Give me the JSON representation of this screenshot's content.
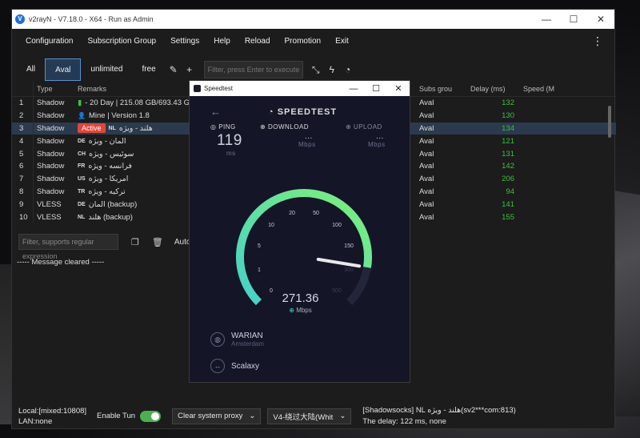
{
  "window": {
    "title": "v2rayN - V7.18.0 - X64 - Run as Admin"
  },
  "menu": [
    "Configuration",
    "Subscription Group",
    "Settings",
    "Help",
    "Reload",
    "Promotion",
    "Exit"
  ],
  "tabs": [
    "All",
    "Aval",
    "unlimited",
    "free"
  ],
  "active_tab": "Aval",
  "search_placeholder": "Filter, press Enter to execute",
  "columns": {
    "num": "",
    "type": "Type",
    "remarks": "Remarks",
    "subs": "Subs grou",
    "delay": "Delay (ms)",
    "speed": "Speed (M"
  },
  "rows": [
    {
      "num": "1",
      "type": "Shadow",
      "remarks": "- 20 Day | 215.08 GB/693.43 GB",
      "subs": "Aval",
      "delay": "132"
    },
    {
      "num": "2",
      "type": "Shadow",
      "remarks": "Mine | Version 1.8",
      "subs": "Aval",
      "delay": "130"
    },
    {
      "num": "3",
      "type": "Shadow",
      "badge": "Active",
      "flag": "NL",
      "remarks": "هلند - ویژه",
      "subs": "Aval",
      "delay": "134"
    },
    {
      "num": "4",
      "type": "Shadow",
      "flag": "DE",
      "remarks": "آلمان - ویژه",
      "subs": "Aval",
      "delay": "121"
    },
    {
      "num": "5",
      "type": "Shadow",
      "flag": "CH",
      "remarks": "سوئیس - ویژه",
      "subs": "Aval",
      "delay": "131"
    },
    {
      "num": "6",
      "type": "Shadow",
      "flag": "FR",
      "remarks": "فرانسه - ویژه",
      "subs": "Aval",
      "delay": "142"
    },
    {
      "num": "7",
      "type": "Shadow",
      "flag": "US",
      "remarks": "آمریکا - ویژه",
      "subs": "Aval",
      "delay": "206"
    },
    {
      "num": "8",
      "type": "Shadow",
      "flag": "TR",
      "remarks": "ترکیه - ویژه",
      "subs": "Aval",
      "delay": "94"
    },
    {
      "num": "9",
      "type": "VLESS",
      "flag": "DE",
      "remarks": "آلمان (backup)",
      "subs": "Aval",
      "delay": "141"
    },
    {
      "num": "10",
      "type": "VLESS",
      "flag": "NL",
      "remarks": "هلند (backup)",
      "subs": "Aval",
      "delay": "155"
    }
  ],
  "msg_filter_placeholder": "Filter, supports regular expression",
  "auto_label": "Auto",
  "message": "----- Message cleared -----",
  "status": {
    "local": "Local:[mixed:10808]",
    "lan": "LAN:none",
    "tun_label": "Enable Tun",
    "proxy_select": "Clear system proxy",
    "routing_select": "V4-绕过大陆(Whit",
    "server_line": "[Shadowsocks] NL هلند - ویژه(sv2***com:813)",
    "delay_line": "The delay: 122 ms, none"
  },
  "speedtest": {
    "title": "Speedtest",
    "logo": "SPEEDTEST",
    "ping_label": "PING",
    "ping_value": "119",
    "ping_unit": "ms",
    "download_label": "DOWNLOAD",
    "download_value": "...",
    "download_unit": "Mbps",
    "upload_label": "UPLOAD",
    "upload_value": "...",
    "upload_unit": "Mbps",
    "speed": "271.36",
    "speed_unit": "Mbps",
    "gauge_ticks": [
      "0",
      "1",
      "5",
      "10",
      "20",
      "50",
      "100",
      "150",
      "300",
      "500"
    ],
    "gauge_value": 271.36,
    "isp": "WARIAN",
    "isp_location": "Amsterdam",
    "server": "Scalaxy"
  }
}
